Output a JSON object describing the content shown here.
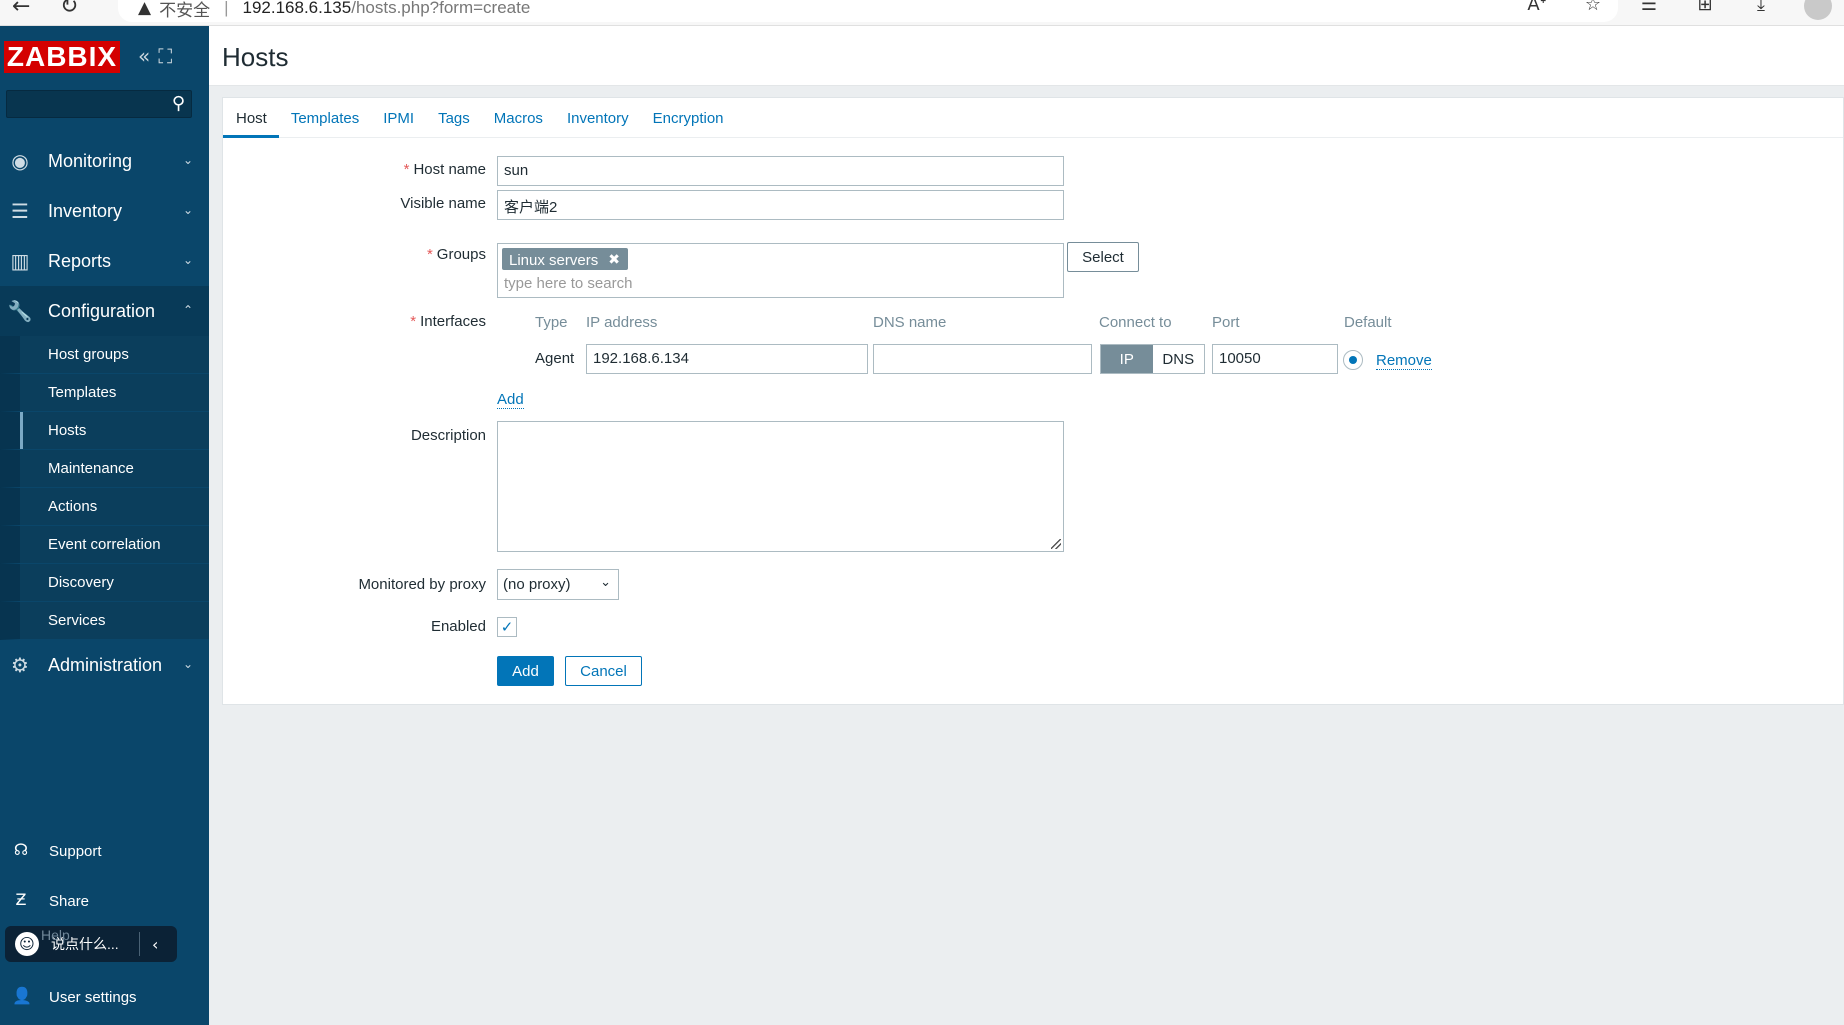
{
  "browser": {
    "warning_text": "不安全",
    "url_host": "192.168.6.135",
    "url_path": "/hosts.php?form=create",
    "icons": [
      "read-aloud-icon",
      "add-favorite-icon",
      "favorites-icon",
      "collections-icon",
      "downloads-icon",
      "profile-icon"
    ]
  },
  "sidebar": {
    "logo": "ZABBIX",
    "search_placeholder": "",
    "menu": [
      {
        "label": "Monitoring",
        "icon": "eye-icon"
      },
      {
        "label": "Inventory",
        "icon": "list-icon"
      },
      {
        "label": "Reports",
        "icon": "bar-chart-icon"
      },
      {
        "label": "Configuration",
        "icon": "wrench-icon"
      }
    ],
    "config_submenu": [
      "Host groups",
      "Templates",
      "Hosts",
      "Maintenance",
      "Actions",
      "Event correlation",
      "Discovery",
      "Services"
    ],
    "admin_label": "Administration",
    "bottom": {
      "support": "Support",
      "share": "Share",
      "help": "Help",
      "user_settings": "User settings"
    },
    "chat_widget_text": "说点什么..."
  },
  "header": {
    "title": "Hosts"
  },
  "tabs": [
    "Host",
    "Templates",
    "IPMI",
    "Tags",
    "Macros",
    "Inventory",
    "Encryption"
  ],
  "form": {
    "host_name_label": "Host name",
    "host_name_value": "sun",
    "visible_name_label": "Visible name",
    "visible_name_value": "客户端2",
    "groups_label": "Groups",
    "group_chip": "Linux servers",
    "group_chip_remove": "✖",
    "groups_placeholder": "type here to search",
    "select_button": "Select",
    "interfaces_label": "Interfaces",
    "iface_headers": {
      "type": "Type",
      "ip": "IP address",
      "dns": "DNS name",
      "connect": "Connect to",
      "port": "Port",
      "default": "Default"
    },
    "iface_row": {
      "type": "Agent",
      "ip": "192.168.6.134",
      "dns": "",
      "connect_ip": "IP",
      "connect_dns": "DNS",
      "port": "10050",
      "remove": "Remove"
    },
    "add_interface": "Add",
    "description_label": "Description",
    "description_value": "",
    "proxy_label": "Monitored by proxy",
    "proxy_value": "(no proxy)",
    "enabled_label": "Enabled",
    "enabled_checked": true,
    "add_button": "Add",
    "cancel_button": "Cancel"
  },
  "colors": {
    "sidebar": "#0a466a",
    "accent": "#0275b8",
    "logo_red": "#d40000",
    "required": "#e45959"
  }
}
